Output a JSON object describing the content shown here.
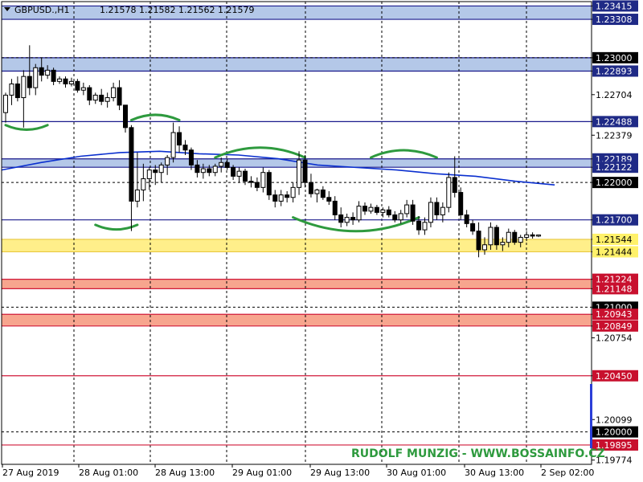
{
  "header": {
    "symbol": "GBPUSD.,H1",
    "ohlc": "1.21578 1.21582 1.21562 1.21579"
  },
  "watermark": "RUDOLF MUNZIG - WWW.BOSSAINFO.CZ",
  "colors": {
    "background": "#ffffff",
    "candle_outline": "#000000",
    "candle_bear": "#000000",
    "candle_bull": "#ffffff",
    "moving_average": "#0a2fcf",
    "level_line_blue": "#1a1a8c",
    "zone_blue": "#b4c8e8",
    "zone_yellow": "#ffef8a",
    "zone_red": "#f7a58e",
    "level_line_red": "#d01a3a",
    "arc_green": "#2e9a3e",
    "grid": "#000000"
  },
  "chart_data": {
    "type": "candlestick",
    "x_ticks": [
      "27 Aug 2019",
      "28 Aug 01:00",
      "28 Aug 13:00",
      "29 Aug 01:00",
      "29 Aug 13:00",
      "30 Aug 01:00",
      "30 Aug 13:00",
      "2 Sep 02:00"
    ],
    "y_ticks": [
      "1.23415",
      "1.23308",
      "1.23000",
      "1.22893",
      "1.22704",
      "1.22488",
      "1.22379",
      "1.22189",
      "1.22122",
      "1.22000",
      "1.21700",
      "1.21544",
      "1.21444",
      "1.21224",
      "1.21148",
      "1.21000",
      "1.20943",
      "1.20849",
      "1.20754",
      "1.20450",
      "1.20099",
      "1.20000",
      "1.19895",
      "1.19774"
    ],
    "ylim": [
      1.1974,
      1.2345
    ],
    "zones": [
      {
        "type": "blue",
        "from": 1.23308,
        "to": 1.23415
      },
      {
        "type": "blue",
        "from": 1.22893,
        "to": 1.23
      },
      {
        "type": "blue",
        "from": 1.22122,
        "to": 1.22189
      },
      {
        "type": "yellow",
        "from": 1.21444,
        "to": 1.21544
      },
      {
        "type": "red",
        "from": 1.21148,
        "to": 1.21224
      },
      {
        "type": "red",
        "from": 1.20849,
        "to": 1.20943
      }
    ],
    "lines": [
      {
        "type": "blue",
        "value": 1.22488
      },
      {
        "type": "blue",
        "value": 1.217
      },
      {
        "type": "red",
        "value": 1.2045
      },
      {
        "type": "red",
        "value": 1.19895
      }
    ],
    "dotted_levels": [
      1.23,
      1.22,
      1.21,
      1.2
    ],
    "candles": [
      {
        "o": 1.2256,
        "h": 1.2272,
        "l": 1.2248,
        "c": 1.227
      },
      {
        "o": 1.227,
        "h": 1.2283,
        "l": 1.2262,
        "c": 1.2279
      },
      {
        "o": 1.2279,
        "h": 1.2285,
        "l": 1.2265,
        "c": 1.2268
      },
      {
        "o": 1.2268,
        "h": 1.229,
        "l": 1.2244,
        "c": 1.2285
      },
      {
        "o": 1.2285,
        "h": 1.231,
        "l": 1.227,
        "c": 1.2276
      },
      {
        "o": 1.2276,
        "h": 1.2295,
        "l": 1.227,
        "c": 1.2292
      },
      {
        "o": 1.2292,
        "h": 1.23,
        "l": 1.2281,
        "c": 1.2286
      },
      {
        "o": 1.2286,
        "h": 1.2294,
        "l": 1.2283,
        "c": 1.229
      },
      {
        "o": 1.229,
        "h": 1.2292,
        "l": 1.2278,
        "c": 1.2281
      },
      {
        "o": 1.2281,
        "h": 1.2285,
        "l": 1.2279,
        "c": 1.2283
      },
      {
        "o": 1.2283,
        "h": 1.2285,
        "l": 1.2276,
        "c": 1.2279
      },
      {
        "o": 1.2279,
        "h": 1.2284,
        "l": 1.2277,
        "c": 1.2281
      },
      {
        "o": 1.2281,
        "h": 1.2283,
        "l": 1.2272,
        "c": 1.2274
      },
      {
        "o": 1.2274,
        "h": 1.228,
        "l": 1.227,
        "c": 1.2276
      },
      {
        "o": 1.2276,
        "h": 1.2278,
        "l": 1.2262,
        "c": 1.2266
      },
      {
        "o": 1.2266,
        "h": 1.2272,
        "l": 1.2263,
        "c": 1.227
      },
      {
        "o": 1.227,
        "h": 1.2275,
        "l": 1.2262,
        "c": 1.2265
      },
      {
        "o": 1.2265,
        "h": 1.2272,
        "l": 1.226,
        "c": 1.2268
      },
      {
        "o": 1.2268,
        "h": 1.228,
        "l": 1.2265,
        "c": 1.2276
      },
      {
        "o": 1.2276,
        "h": 1.2282,
        "l": 1.2258,
        "c": 1.2262
      },
      {
        "o": 1.2262,
        "h": 1.2262,
        "l": 1.224,
        "c": 1.2244
      },
      {
        "o": 1.2244,
        "h": 1.2246,
        "l": 1.2161,
        "c": 1.2185
      },
      {
        "o": 1.2185,
        "h": 1.2224,
        "l": 1.218,
        "c": 1.2194
      },
      {
        "o": 1.2194,
        "h": 1.2215,
        "l": 1.2185,
        "c": 1.2203
      },
      {
        "o": 1.2203,
        "h": 1.2212,
        "l": 1.2194,
        "c": 1.221
      },
      {
        "o": 1.221,
        "h": 1.2214,
        "l": 1.2198,
        "c": 1.2208
      },
      {
        "o": 1.2208,
        "h": 1.2216,
        "l": 1.22,
        "c": 1.2214
      },
      {
        "o": 1.2214,
        "h": 1.2222,
        "l": 1.2206,
        "c": 1.222
      },
      {
        "o": 1.222,
        "h": 1.2248,
        "l": 1.2216,
        "c": 1.224
      },
      {
        "o": 1.224,
        "h": 1.2245,
        "l": 1.2224,
        "c": 1.223
      },
      {
        "o": 1.223,
        "h": 1.2234,
        "l": 1.2222,
        "c": 1.2226
      },
      {
        "o": 1.2226,
        "h": 1.2228,
        "l": 1.221,
        "c": 1.2214
      },
      {
        "o": 1.2214,
        "h": 1.2218,
        "l": 1.2204,
        "c": 1.2208
      },
      {
        "o": 1.2208,
        "h": 1.2215,
        "l": 1.2203,
        "c": 1.2211
      },
      {
        "o": 1.2211,
        "h": 1.2214,
        "l": 1.2205,
        "c": 1.2208
      },
      {
        "o": 1.2208,
        "h": 1.2215,
        "l": 1.2205,
        "c": 1.2213
      },
      {
        "o": 1.2213,
        "h": 1.222,
        "l": 1.2208,
        "c": 1.2216
      },
      {
        "o": 1.2216,
        "h": 1.2219,
        "l": 1.221,
        "c": 1.2212
      },
      {
        "o": 1.2212,
        "h": 1.2214,
        "l": 1.2202,
        "c": 1.2205
      },
      {
        "o": 1.2205,
        "h": 1.2212,
        "l": 1.22,
        "c": 1.2209
      },
      {
        "o": 1.2209,
        "h": 1.2211,
        "l": 1.2198,
        "c": 1.2201
      },
      {
        "o": 1.2201,
        "h": 1.2205,
        "l": 1.2196,
        "c": 1.22
      },
      {
        "o": 1.22,
        "h": 1.2204,
        "l": 1.2193,
        "c": 1.2196
      },
      {
        "o": 1.2196,
        "h": 1.2212,
        "l": 1.2192,
        "c": 1.2208
      },
      {
        "o": 1.2208,
        "h": 1.221,
        "l": 1.2186,
        "c": 1.219
      },
      {
        "o": 1.219,
        "h": 1.2194,
        "l": 1.218,
        "c": 1.2185
      },
      {
        "o": 1.2185,
        "h": 1.2194,
        "l": 1.2181,
        "c": 1.219
      },
      {
        "o": 1.219,
        "h": 1.2193,
        "l": 1.2184,
        "c": 1.2188
      },
      {
        "o": 1.2188,
        "h": 1.22,
        "l": 1.2184,
        "c": 1.2196
      },
      {
        "o": 1.2196,
        "h": 1.2225,
        "l": 1.219,
        "c": 1.2218
      },
      {
        "o": 1.2218,
        "h": 1.2222,
        "l": 1.2196,
        "c": 1.22
      },
      {
        "o": 1.22,
        "h": 1.2207,
        "l": 1.2188,
        "c": 1.2191
      },
      {
        "o": 1.2191,
        "h": 1.2195,
        "l": 1.2184,
        "c": 1.2194
      },
      {
        "o": 1.2194,
        "h": 1.2197,
        "l": 1.2186,
        "c": 1.2188
      },
      {
        "o": 1.2188,
        "h": 1.2193,
        "l": 1.2182,
        "c": 1.2185
      },
      {
        "o": 1.2185,
        "h": 1.2189,
        "l": 1.217,
        "c": 1.2174
      },
      {
        "o": 1.2174,
        "h": 1.218,
        "l": 1.2164,
        "c": 1.2168
      },
      {
        "o": 1.2168,
        "h": 1.2175,
        "l": 1.2165,
        "c": 1.2172
      },
      {
        "o": 1.2172,
        "h": 1.2176,
        "l": 1.2166,
        "c": 1.217
      },
      {
        "o": 1.217,
        "h": 1.2185,
        "l": 1.2168,
        "c": 1.2181
      },
      {
        "o": 1.2181,
        "h": 1.2184,
        "l": 1.2174,
        "c": 1.2177
      },
      {
        "o": 1.2177,
        "h": 1.2183,
        "l": 1.2175,
        "c": 1.218
      },
      {
        "o": 1.218,
        "h": 1.2182,
        "l": 1.2174,
        "c": 1.2176
      },
      {
        "o": 1.2176,
        "h": 1.218,
        "l": 1.2172,
        "c": 1.2178
      },
      {
        "o": 1.2178,
        "h": 1.2181,
        "l": 1.2172,
        "c": 1.2174
      },
      {
        "o": 1.2174,
        "h": 1.2177,
        "l": 1.2168,
        "c": 1.217
      },
      {
        "o": 1.217,
        "h": 1.2178,
        "l": 1.2167,
        "c": 1.2175
      },
      {
        "o": 1.2175,
        "h": 1.2186,
        "l": 1.2172,
        "c": 1.2182
      },
      {
        "o": 1.2182,
        "h": 1.2186,
        "l": 1.2166,
        "c": 1.2169
      },
      {
        "o": 1.2169,
        "h": 1.2173,
        "l": 1.2158,
        "c": 1.2162
      },
      {
        "o": 1.2162,
        "h": 1.2172,
        "l": 1.2158,
        "c": 1.2168
      },
      {
        "o": 1.2168,
        "h": 1.2188,
        "l": 1.2164,
        "c": 1.2184
      },
      {
        "o": 1.2184,
        "h": 1.2188,
        "l": 1.217,
        "c": 1.2174
      },
      {
        "o": 1.2174,
        "h": 1.2184,
        "l": 1.2168,
        "c": 1.218
      },
      {
        "o": 1.218,
        "h": 1.2208,
        "l": 1.2176,
        "c": 1.2204
      },
      {
        "o": 1.2204,
        "h": 1.2221,
        "l": 1.2188,
        "c": 1.2192
      },
      {
        "o": 1.2192,
        "h": 1.2196,
        "l": 1.217,
        "c": 1.2174
      },
      {
        "o": 1.2174,
        "h": 1.2178,
        "l": 1.2164,
        "c": 1.2167
      },
      {
        "o": 1.2167,
        "h": 1.217,
        "l": 1.2158,
        "c": 1.2161
      },
      {
        "o": 1.2161,
        "h": 1.2168,
        "l": 1.214,
        "c": 1.2146
      },
      {
        "o": 1.2146,
        "h": 1.2156,
        "l": 1.2142,
        "c": 1.215
      },
      {
        "o": 1.215,
        "h": 1.2168,
        "l": 1.2146,
        "c": 1.2164
      },
      {
        "o": 1.2164,
        "h": 1.2166,
        "l": 1.2146,
        "c": 1.215
      },
      {
        "o": 1.215,
        "h": 1.2156,
        "l": 1.2145,
        "c": 1.2152
      },
      {
        "o": 1.2152,
        "h": 1.2163,
        "l": 1.2148,
        "c": 1.216
      },
      {
        "o": 1.216,
        "h": 1.2162,
        "l": 1.215,
        "c": 1.2152
      },
      {
        "o": 1.2152,
        "h": 1.2158,
        "l": 1.2148,
        "c": 1.2156
      },
      {
        "o": 1.2156,
        "h": 1.2161,
        "l": 1.2153,
        "c": 1.2158
      },
      {
        "o": 1.2158,
        "h": 1.216,
        "l": 1.2155,
        "c": 1.2157
      },
      {
        "o": 1.2157,
        "h": 1.21582,
        "l": 1.21562,
        "c": 1.21579
      }
    ],
    "moving_average": [
      1.221,
      1.2216,
      1.2221,
      1.2224,
      1.2225,
      1.2223,
      1.2222,
      1.2219,
      1.2214,
      1.2212,
      1.221,
      1.2207,
      1.2205,
      1.2201,
      1.2198
    ],
    "arcs": [
      {
        "type": "bottom",
        "x0": 0,
        "x1": 7,
        "y": 1.2246
      },
      {
        "type": "top",
        "x0": 21,
        "x1": 29,
        "y": 1.225
      },
      {
        "type": "bottom",
        "x0": 15,
        "x1": 22,
        "y": 1.2166
      },
      {
        "type": "top",
        "x0": 35,
        "x1": 50,
        "y": 1.222
      },
      {
        "type": "bottom",
        "x0": 48,
        "x1": 69,
        "y": 1.2172
      },
      {
        "type": "top",
        "x0": 61,
        "x1": 72,
        "y": 1.222
      }
    ]
  }
}
